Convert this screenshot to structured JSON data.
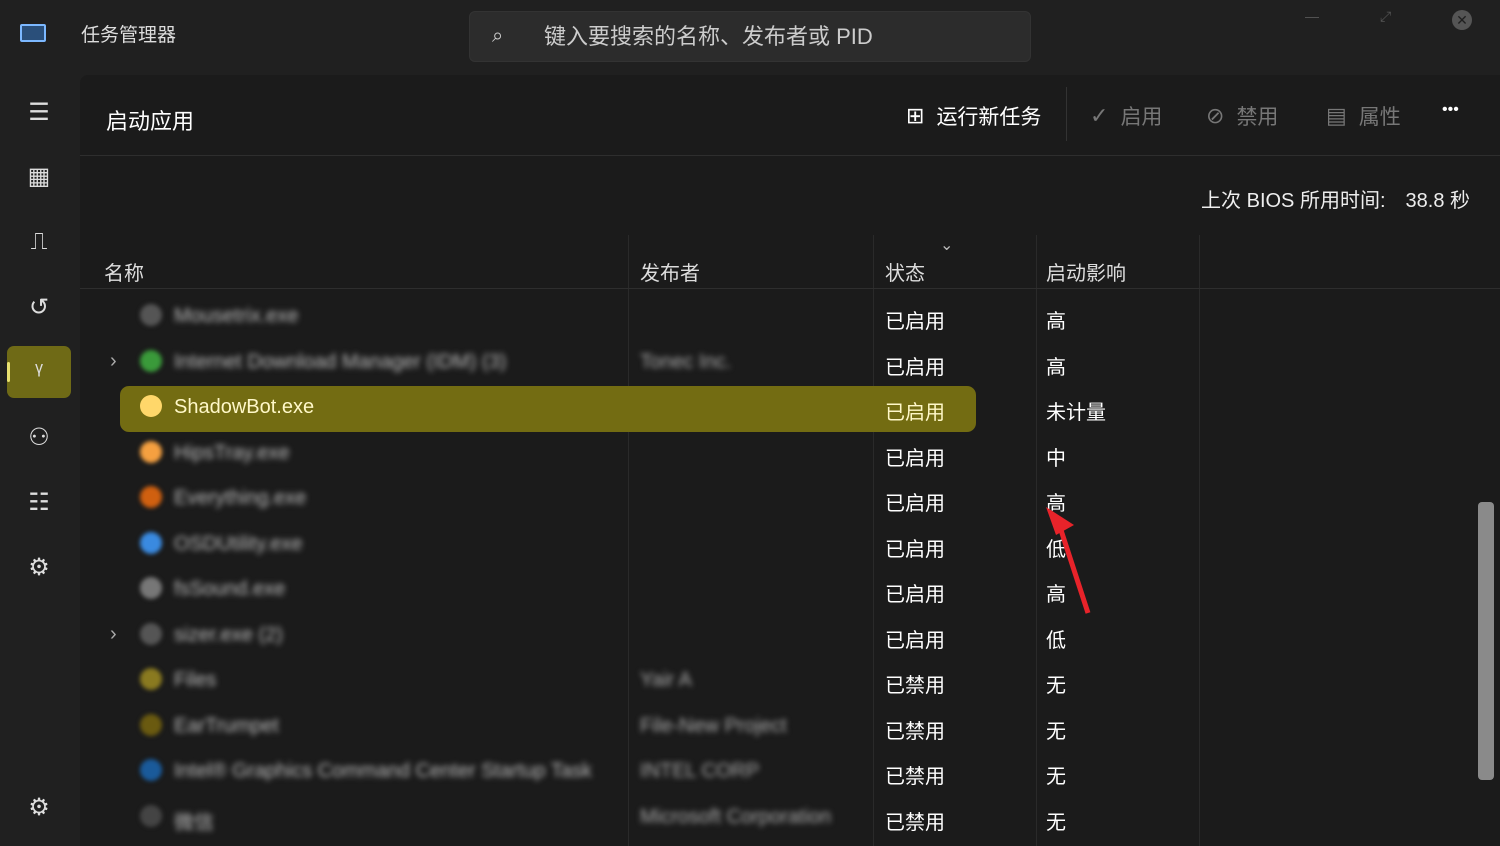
{
  "window": {
    "title": "任务管理器",
    "search_placeholder": "键入要搜索的名称、发布者或 PID"
  },
  "nav": [
    {
      "icon": "hamburger-icon"
    },
    {
      "icon": "processes-icon"
    },
    {
      "icon": "performance-icon"
    },
    {
      "icon": "app-history-icon"
    },
    {
      "icon": "startup-apps-icon",
      "active": true
    },
    {
      "icon": "users-icon"
    },
    {
      "icon": "details-icon"
    },
    {
      "icon": "services-icon"
    },
    {
      "icon": "settings-icon"
    }
  ],
  "page": {
    "title": "启动应用"
  },
  "toolbar": {
    "run_new_task": "运行新任务",
    "enable": "启用",
    "disable": "禁用",
    "properties": "属性",
    "more": "•••"
  },
  "bios": {
    "label": "上次 BIOS 所用时间:",
    "value": "38.8 秒"
  },
  "columns": {
    "name": "名称",
    "publisher": "发布者",
    "status": "状态",
    "impact": "启动影响"
  },
  "rows": [
    {
      "name": "Mousetrix.exe",
      "publisher": "",
      "status": "已启用",
      "impact": "高",
      "color": "#555"
    },
    {
      "name": "Internet Download Manager (IDM) (3)",
      "publisher": "Tonec Inc.",
      "status": "已启用",
      "impact": "高",
      "color": "#3a9a3a",
      "expand": true
    },
    {
      "name": "ShadowBot.exe",
      "publisher": "",
      "status": "已启用",
      "impact": "未计量",
      "color": "#ffd76a",
      "selected": true
    },
    {
      "name": "HipsTray.exe",
      "publisher": "",
      "status": "已启用",
      "impact": "中",
      "color": "#f5a040"
    },
    {
      "name": "Everything.exe",
      "publisher": "",
      "status": "已启用",
      "impact": "高",
      "color": "#d06010"
    },
    {
      "name": "OSDUtility.exe",
      "publisher": "",
      "status": "已启用",
      "impact": "低",
      "color": "#3a8ae0"
    },
    {
      "name": "fsSound.exe",
      "publisher": "",
      "status": "已启用",
      "impact": "高",
      "color": "#777"
    },
    {
      "name": "sizer.exe (2)",
      "publisher": "",
      "status": "已启用",
      "impact": "低",
      "color": "#555",
      "expand": true
    },
    {
      "name": "Files",
      "publisher": "Yair A",
      "status": "已禁用",
      "impact": "无",
      "color": "#8a7a20"
    },
    {
      "name": "EarTrumpet",
      "publisher": "File-New Project",
      "status": "已禁用",
      "impact": "无",
      "color": "#6a5a10"
    },
    {
      "name": "Intel® Graphics Command Center Startup Task",
      "publisher": "INTEL CORP",
      "status": "已禁用",
      "impact": "无",
      "color": "#1a5a9a"
    },
    {
      "name": "微信",
      "publisher": "Microsoft Corporation",
      "status": "已禁用",
      "impact": "无",
      "color": "#444"
    }
  ]
}
